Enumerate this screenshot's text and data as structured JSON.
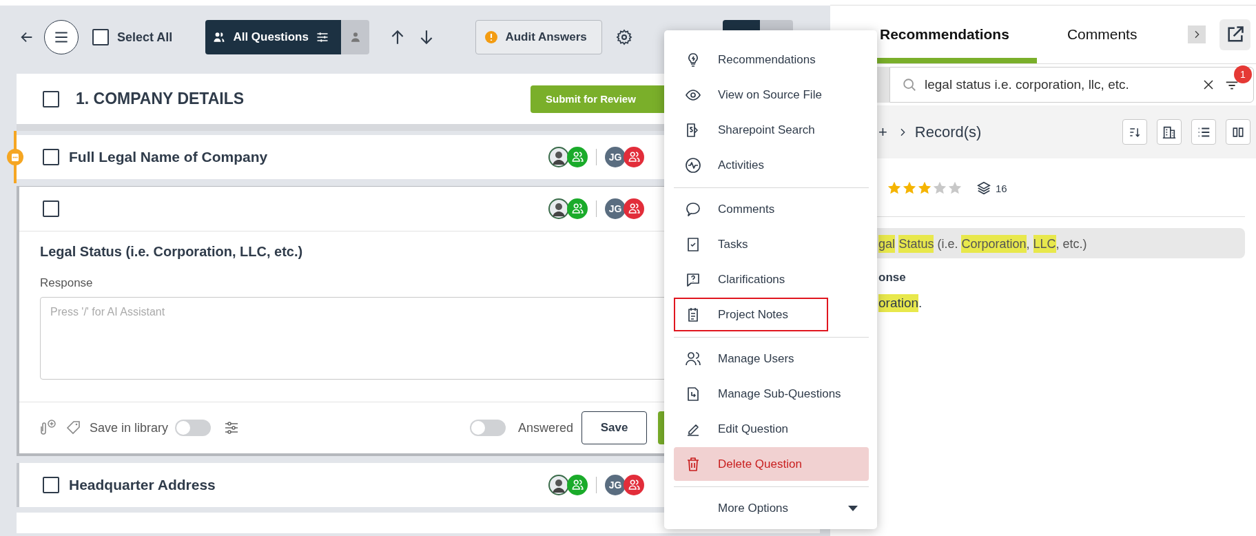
{
  "toolbar": {
    "select_all": {
      "label": "Select All",
      "checked": false
    },
    "question_filter": {
      "label": "All Questions",
      "selected": true
    },
    "audit_button": {
      "label": "Audit Answers"
    },
    "view_switch": {
      "selected": true
    }
  },
  "section": {
    "title": "1. COMPANY DETAILS",
    "checked": false,
    "submit_button": "Submit for Review"
  },
  "questions": [
    {
      "kind": "row",
      "title": "Full Legal Name of Company",
      "checked": false,
      "flagged": true,
      "initials": "JG"
    },
    {
      "kind": "editor",
      "checked": false,
      "initials": "JG",
      "question": "Legal Status (i.e. Corporation, LLC, etc.)",
      "response_label": "Response",
      "response": {
        "placeholder": "Press '/' for AI Assistant"
      },
      "save_in_library": {
        "label": "Save in library",
        "on": false
      },
      "answered": {
        "label": "Answered",
        "on": false
      },
      "save_button": "Save"
    },
    {
      "kind": "row",
      "title": "Headquarter Address",
      "checked": false,
      "flagged": false,
      "initials": "JG"
    }
  ],
  "menu": {
    "groups": [
      [
        {
          "label": "Recommendations",
          "kind": "normal",
          "outlined": false
        },
        {
          "label": "View on Source File",
          "kind": "normal",
          "outlined": false
        },
        {
          "label": "Sharepoint Search",
          "kind": "normal",
          "outlined": false
        },
        {
          "label": "Activities",
          "kind": "normal",
          "outlined": false
        }
      ],
      [
        {
          "label": "Comments",
          "kind": "normal",
          "outlined": false
        },
        {
          "label": "Tasks",
          "kind": "normal",
          "outlined": false
        },
        {
          "label": "Clarifications",
          "kind": "normal",
          "outlined": false
        },
        {
          "label": "Project Notes",
          "kind": "normal",
          "outlined": true
        }
      ],
      [
        {
          "label": "Manage Users",
          "kind": "normal",
          "outlined": false
        },
        {
          "label": "Manage Sub-Questions",
          "kind": "normal",
          "outlined": false
        },
        {
          "label": "Edit Question",
          "kind": "normal",
          "outlined": false
        },
        {
          "label": "Delete Question",
          "kind": "danger",
          "outlined": false
        }
      ]
    ],
    "more": {
      "label": "More Options"
    }
  },
  "panel": {
    "tabs": [
      {
        "label": "Recommendations",
        "selected": true
      },
      {
        "label": "Comments",
        "selected": false
      }
    ],
    "search": {
      "value": "legal status i.e. corporation, llc, etc.",
      "filter_count": "1"
    },
    "breadcrumb": {
      "root": "+",
      "current": "Record(s)"
    },
    "result": {
      "stars": 3,
      "count": "16",
      "question": [
        {
          "text": "gal",
          "highlight": true
        },
        {
          "text": "Status",
          "highlight": true,
          "trailing": " (i.e. "
        },
        {
          "text": "Corporation",
          "highlight": true,
          "trailing": ", "
        },
        {
          "text": "LLC",
          "highlight": true,
          "trailing": ", etc.)"
        }
      ],
      "response_label": "onse",
      "response": [
        {
          "text": "oration",
          "highlight": true,
          "trailing": "."
        }
      ]
    }
  }
}
